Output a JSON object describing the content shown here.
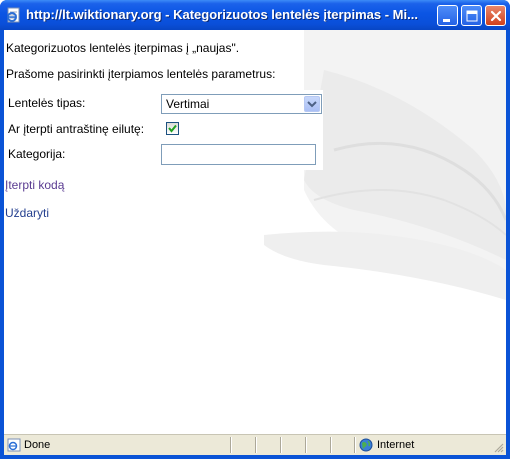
{
  "window": {
    "title": "http://lt.wiktionary.org - Kategorizuotos lentelės įterpimas - Mi..."
  },
  "content": {
    "intro_line": "Kategorizuotos lentelės įterpimas į „naujas\".",
    "instruction_line": "Prašome pasirinkti įterpiamos lentelės parametrus:"
  },
  "form": {
    "table_type_label": "Lentelės tipas:",
    "table_type_value": "Vertimai",
    "header_row_label": "Ar įterpti antraštinę eilutę:",
    "header_row_checked": true,
    "category_label": "Kategorija:",
    "category_value": ""
  },
  "links": {
    "insert_code": "Įterpti kodą",
    "close": "Uždaryti"
  },
  "statusbar": {
    "status_text": "Done",
    "zone_text": "Internet"
  },
  "icons": {
    "title_icon": "ie-page-icon",
    "status_icon": "ie-done-icon",
    "zone_icon": "globe-icon"
  },
  "colors": {
    "titlebar": "#0a4fd9",
    "link_visited": "#5a3b91",
    "link": "#243f8f",
    "statusbar": "#ece9d8"
  }
}
